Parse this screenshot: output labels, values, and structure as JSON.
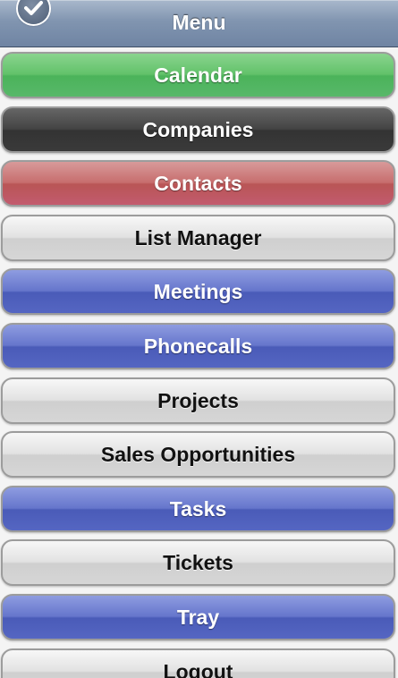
{
  "header": {
    "title": "Menu",
    "done_icon": "checkmark-icon"
  },
  "theme": {
    "green": "#4bb35a",
    "dark": "#333333",
    "red": "#b95555",
    "light": "#d6d6d6",
    "blue": "#4a5bb8",
    "header": "#7f93ae"
  },
  "menu": {
    "items": [
      {
        "label": "Calendar",
        "theme": "green"
      },
      {
        "label": "Companies",
        "theme": "dark"
      },
      {
        "label": "Contacts",
        "theme": "red"
      },
      {
        "label": "List Manager",
        "theme": "light"
      },
      {
        "label": "Meetings",
        "theme": "blue"
      },
      {
        "label": "Phonecalls",
        "theme": "blue"
      },
      {
        "label": "Projects",
        "theme": "light"
      },
      {
        "label": "Sales Opportunities",
        "theme": "light"
      },
      {
        "label": "Tasks",
        "theme": "blue"
      },
      {
        "label": "Tickets",
        "theme": "light"
      },
      {
        "label": "Tray",
        "theme": "blue"
      },
      {
        "label": "Logout",
        "theme": "light"
      }
    ]
  }
}
